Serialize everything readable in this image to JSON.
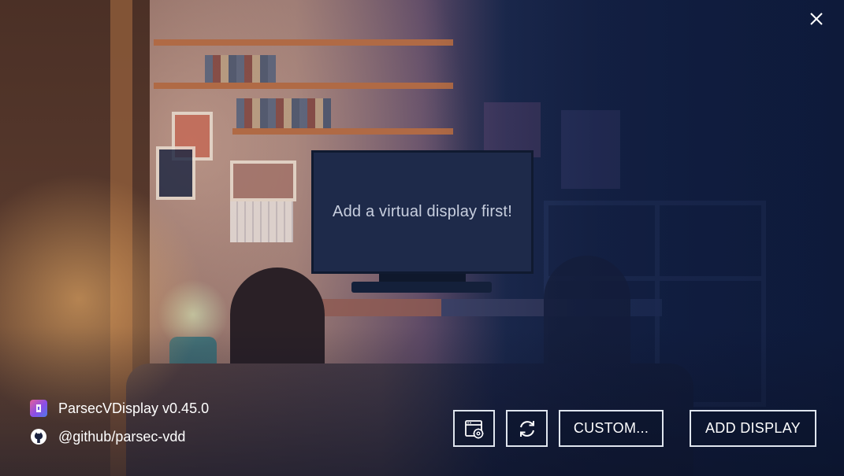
{
  "window": {
    "close_icon": "close-icon",
    "background": "cozy-room-illustration"
  },
  "monitor": {
    "message": "Add a virtual display first!"
  },
  "info": {
    "app_name": "ParsecVDisplay v0.45.0",
    "app_icon": "parsec-logo-icon",
    "github_handle": "@github/parsec-vdd",
    "github_icon": "github-icon"
  },
  "toolbar": {
    "settings_icon": "display-settings-icon",
    "refresh_icon": "refresh-icon",
    "custom_label": "CUSTOM...",
    "add_label": "ADD DISPLAY"
  },
  "colors": {
    "button_border": "#dfe5ee",
    "text": "#ffffff",
    "monitor_screen": "#1e2a4a"
  }
}
